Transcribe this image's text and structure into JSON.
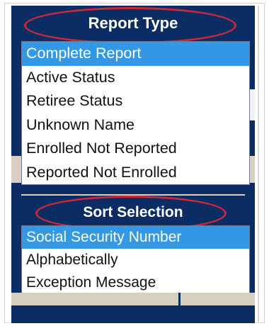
{
  "report_type": {
    "title": "Report Type",
    "items": [
      {
        "label": "Complete Report",
        "selected": true
      },
      {
        "label": "Active Status",
        "selected": false
      },
      {
        "label": "Retiree Status",
        "selected": false
      },
      {
        "label": "Unknown Name",
        "selected": false
      },
      {
        "label": "Enrolled Not Reported",
        "selected": false
      },
      {
        "label": "Reported Not Enrolled",
        "selected": false
      }
    ]
  },
  "sort_selection": {
    "title": "Sort Selection",
    "items": [
      {
        "label": "Social Security Number",
        "selected": true
      },
      {
        "label": "Alphabetically",
        "selected": false
      },
      {
        "label": "Exception Message",
        "selected": false
      }
    ]
  },
  "colors": {
    "panel_background": "#0c2d63",
    "selection_highlight": "#3399e6",
    "annotation_oval": "#c8283a",
    "separator_tan": "#d9cfbe"
  }
}
